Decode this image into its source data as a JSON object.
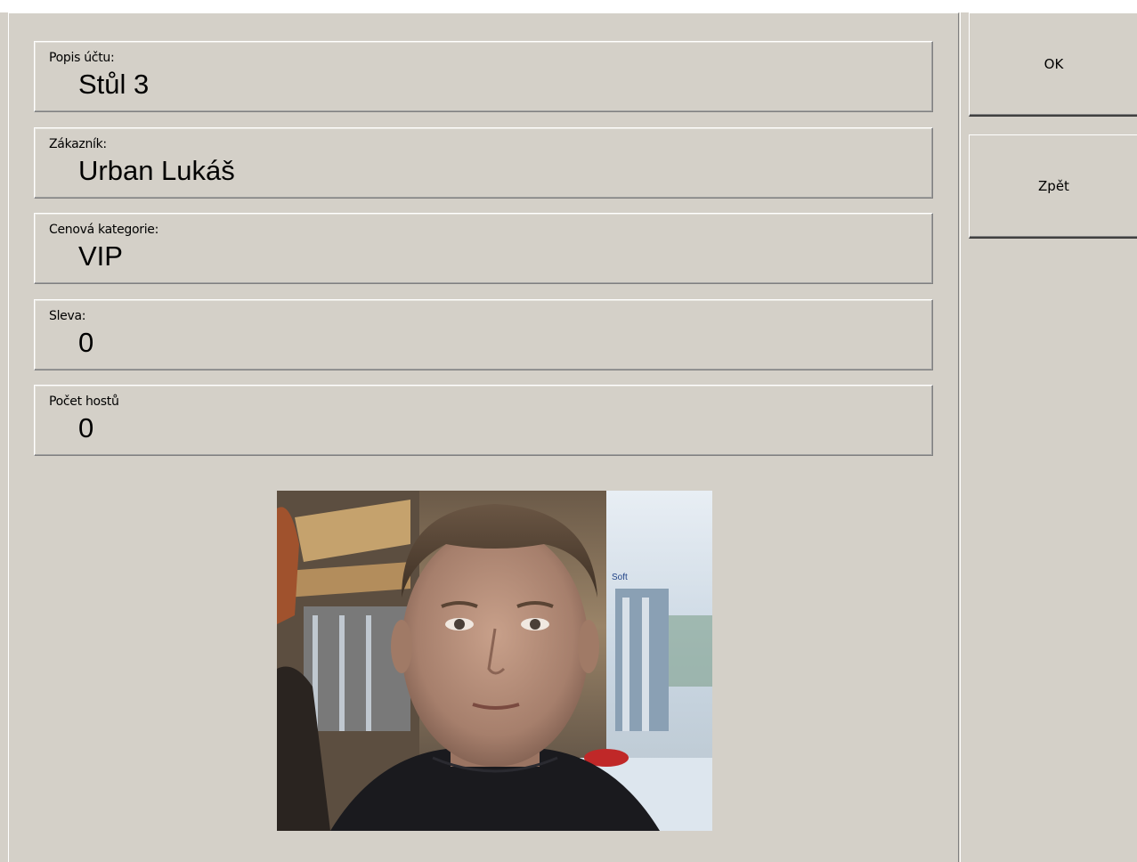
{
  "fields": [
    {
      "label": "Popis účtu:",
      "value": "Stůl 3"
    },
    {
      "label": "Zákazník:",
      "value": "Urban Lukáš"
    },
    {
      "label": "Cenová kategorie:",
      "value": "VIP"
    },
    {
      "label": "Sleva:",
      "value": "0"
    },
    {
      "label": "Počet hostů",
      "value": "0"
    }
  ],
  "buttons": {
    "ok_label": "OK",
    "back_label": "Zpět"
  },
  "colors": {
    "background": "#d4d0c8"
  }
}
